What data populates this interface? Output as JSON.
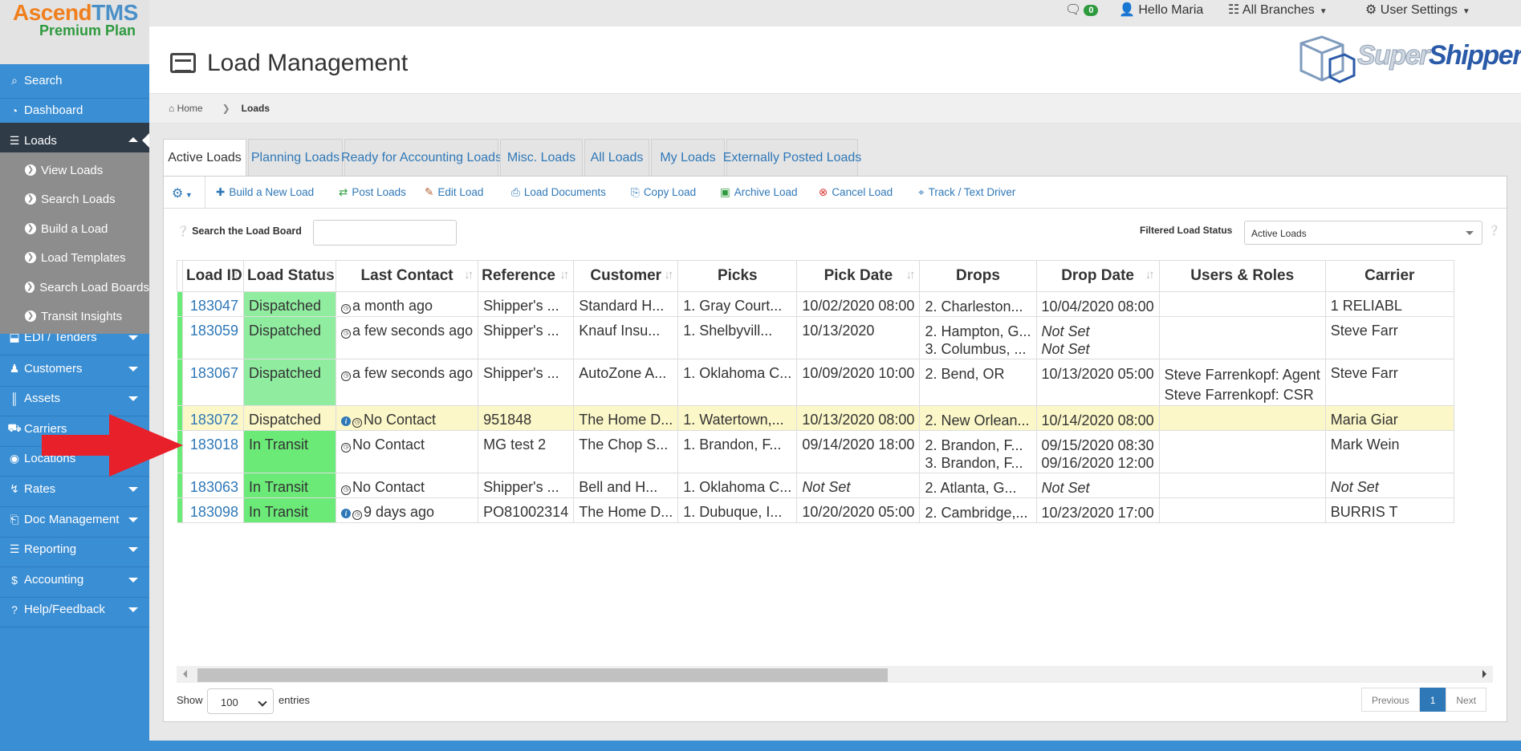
{
  "app": {
    "logo_word1": "Ascend",
    "logo_word2": "TMS",
    "plan": "Premium Plan"
  },
  "topbar": {
    "message_count": "0",
    "hello": "Hello Maria",
    "branches": "All Branches",
    "user_settings": "User Settings"
  },
  "brand": {
    "part1": "Super",
    "part2": "Shippers"
  },
  "sidebar": {
    "items": [
      {
        "label": "Search",
        "icon": "search-icon"
      },
      {
        "label": "Dashboard",
        "icon": "dashboard-icon"
      },
      {
        "label": "Loads",
        "icon": "list-icon"
      },
      {
        "label": "EDI / Tenders",
        "icon": "inbox-icon"
      },
      {
        "label": "Customers",
        "icon": "users-icon"
      },
      {
        "label": "Assets",
        "icon": "barcode-icon"
      },
      {
        "label": "Carriers",
        "icon": "truck-icon"
      },
      {
        "label": "Locations",
        "icon": "map-marker-icon"
      },
      {
        "label": "Rates",
        "icon": "bolt-icon"
      },
      {
        "label": "Doc Management",
        "icon": "file-icon"
      },
      {
        "label": "Reporting",
        "icon": "report-icon"
      },
      {
        "label": "Accounting",
        "icon": "dollar-icon"
      },
      {
        "label": "Help/Feedback",
        "icon": "help-icon"
      }
    ],
    "loads_sub": [
      "View Loads",
      "Search Loads",
      "Build a Load",
      "Load Templates",
      "Search Load Boards",
      "Transit Insights"
    ]
  },
  "page": {
    "title": "Load Management"
  },
  "breadcrumb": {
    "home": "Home",
    "current": "Loads"
  },
  "tabs": [
    "Active Loads",
    "Planning Loads",
    "Ready for Accounting Loads",
    "Misc. Loads",
    "All Loads",
    "My Loads",
    "Externally Posted Loads"
  ],
  "toolbar": [
    "Build a New Load",
    "Post Loads",
    "Edit Load",
    "Load Documents",
    "Copy Load",
    "Archive Load",
    "Cancel Load",
    "Track / Text Driver"
  ],
  "search": {
    "label": "Search the Load Board",
    "value": ""
  },
  "filter": {
    "label": "Filtered Load Status",
    "value": "Active Loads"
  },
  "table": {
    "columns": [
      "Load ID",
      "Load Status",
      "Last Contact",
      "Reference",
      "Customer",
      "Picks",
      "Pick Date",
      "Drops",
      "Drop Date",
      "Users & Roles",
      "Carrier"
    ],
    "rows": [
      {
        "id": "183047",
        "status": "Dispatched",
        "contact": "a month ago",
        "info": false,
        "ref": "Shipper's ...",
        "customer": "Standard H...",
        "picks": "1. Gray Court...",
        "pickdate": "10/02/2020 08:00",
        "drops": [
          "2. Charleston..."
        ],
        "dropdates": [
          "10/04/2020 08:00"
        ],
        "users": [],
        "carrier": "1 RELIABL"
      },
      {
        "id": "183059",
        "status": "Dispatched",
        "contact": "a few seconds ago",
        "info": false,
        "ref": "Shipper's ...",
        "customer": "Knauf Insu...",
        "picks": "1. Shelbyvill...",
        "pickdate": "10/13/2020",
        "drops": [
          "2. Hampton, G...",
          "3. Columbus, ..."
        ],
        "dropdates": [
          "Not Set",
          "Not Set"
        ],
        "users": [],
        "carrier": "Steve Farr"
      },
      {
        "id": "183067",
        "status": "Dispatched",
        "contact": "a few seconds ago",
        "info": false,
        "ref": "Shipper's ...",
        "customer": "AutoZone A...",
        "picks": "1. Oklahoma C...",
        "pickdate": "10/09/2020 10:00",
        "drops": [
          "2. Bend, OR"
        ],
        "dropdates": [
          "10/13/2020 05:00"
        ],
        "users": [
          "Steve Farrenkopf: Agent",
          "Steve Farrenkopf: CSR"
        ],
        "carrier": "Steve Farr"
      },
      {
        "id": "183072",
        "status": "Dispatched",
        "contact": "No Contact",
        "info": true,
        "ref": "951848",
        "customer": "The Home D...",
        "picks": "1. Watertown,...",
        "pickdate": "10/13/2020 08:00",
        "drops": [
          "2. New Orlean..."
        ],
        "dropdates": [
          "10/14/2020 08:00"
        ],
        "users": [],
        "carrier": "Maria Giar"
      },
      {
        "id": "183018",
        "status": "In Transit",
        "contact": "No Contact",
        "info": false,
        "ref": "MG test 2",
        "customer": "The Chop S...",
        "picks": "1. Brandon, F...",
        "pickdate": "09/14/2020 18:00",
        "drops": [
          "2. Brandon, F...",
          "3. Brandon, F..."
        ],
        "dropdates": [
          "09/15/2020 08:30",
          "09/16/2020 12:00"
        ],
        "users": [],
        "carrier": "Mark Wein"
      },
      {
        "id": "183063",
        "status": "In Transit",
        "contact": "No Contact",
        "info": false,
        "ref": "Shipper's ...",
        "customer": "Bell and H...",
        "picks": "1. Oklahoma C...",
        "pickdate": "Not Set",
        "drops": [
          "2. Atlanta, G..."
        ],
        "dropdates": [
          "Not Set"
        ],
        "users": [],
        "carrier": "Not Set"
      },
      {
        "id": "183098",
        "status": "In Transit",
        "contact": "9 days ago",
        "info": true,
        "ref": "PO81002314",
        "customer": "The Home D...",
        "picks": "1. Dubuque, I...",
        "pickdate": "10/20/2020 05:00",
        "drops": [
          "2. Cambridge,..."
        ],
        "dropdates": [
          "10/23/2020 17:00"
        ],
        "users": [],
        "carrier": "BURRIS T"
      }
    ]
  },
  "footer": {
    "show": "Show",
    "entries_value": "100",
    "entries": "entries",
    "prev": "Previous",
    "page": "1",
    "next": "Next"
  },
  "colors": {
    "sidebar": "#3a8ed4",
    "active_nav": "#2f3b47",
    "dispatched": "#90eda0",
    "in_transit": "#6bea78",
    "highlight_row": "#fbf7c8",
    "arrow": "#e8202a"
  }
}
